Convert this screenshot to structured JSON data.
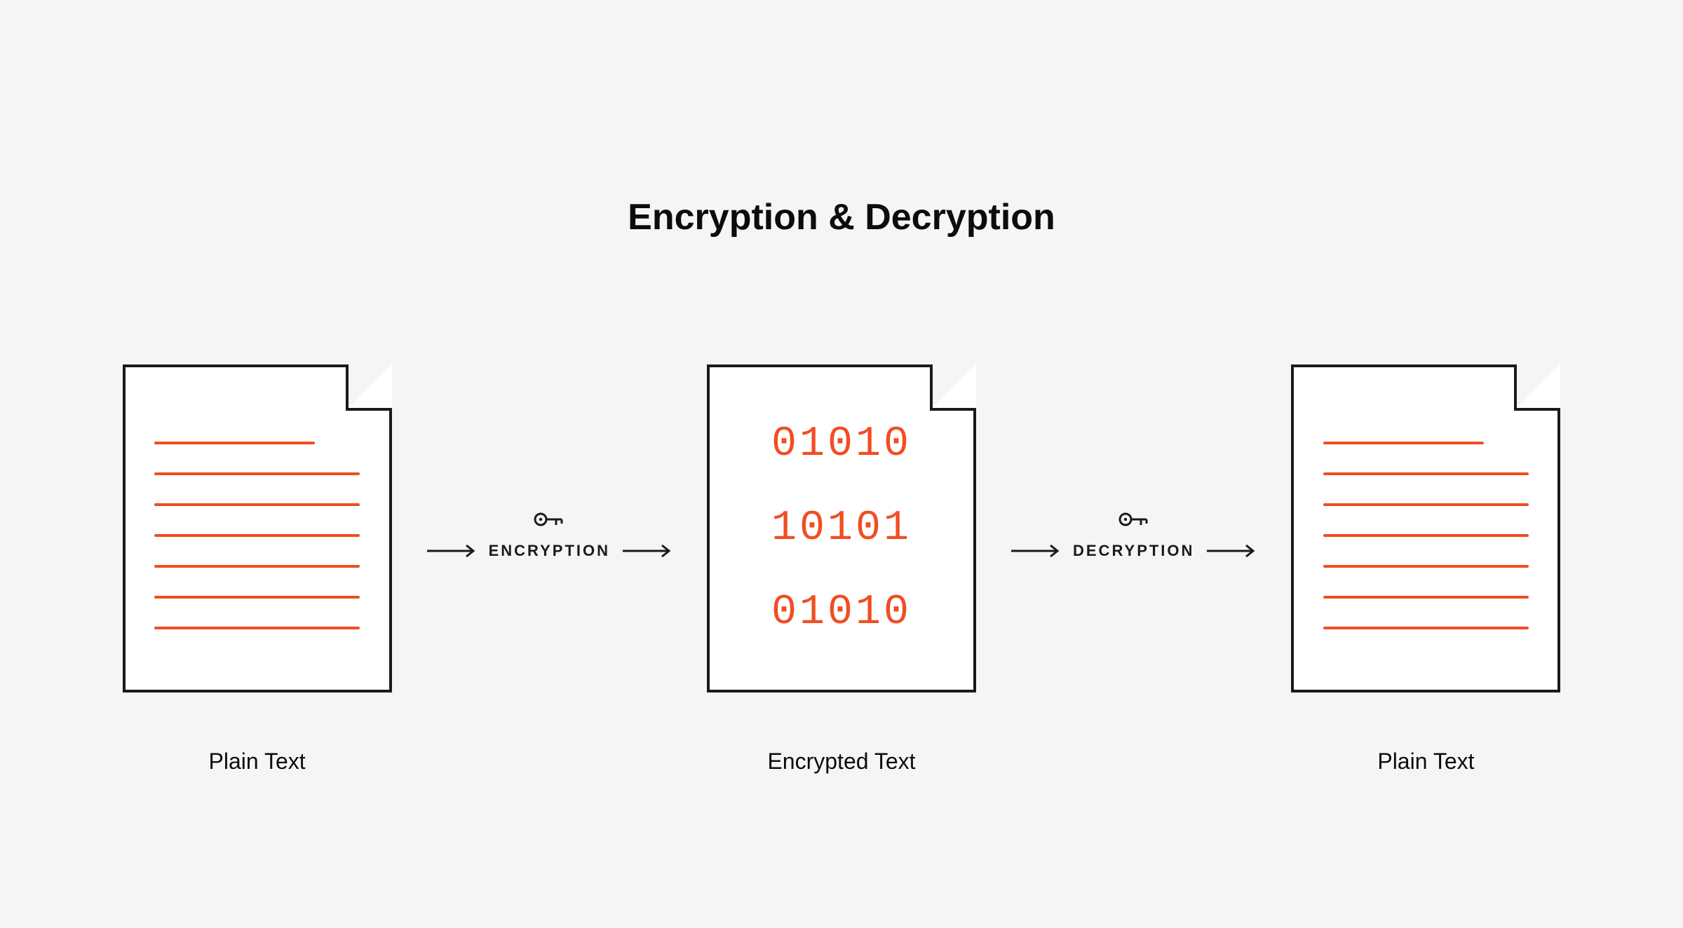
{
  "title": "Encryption & Decryption",
  "stages": {
    "left": {
      "caption": "Plain Text"
    },
    "middle": {
      "caption": "Encrypted Text",
      "binary": [
        "01010",
        "10101",
        "01010"
      ]
    },
    "right": {
      "caption": "Plain Text"
    }
  },
  "connectors": {
    "encrypt": {
      "label": "ENCRYPTION"
    },
    "decrypt": {
      "label": "DECRYPTION"
    }
  },
  "colors": {
    "accent": "#f04e23",
    "ink": "#1a1a1a",
    "bg": "#f5f5f5",
    "paper": "#ffffff"
  }
}
